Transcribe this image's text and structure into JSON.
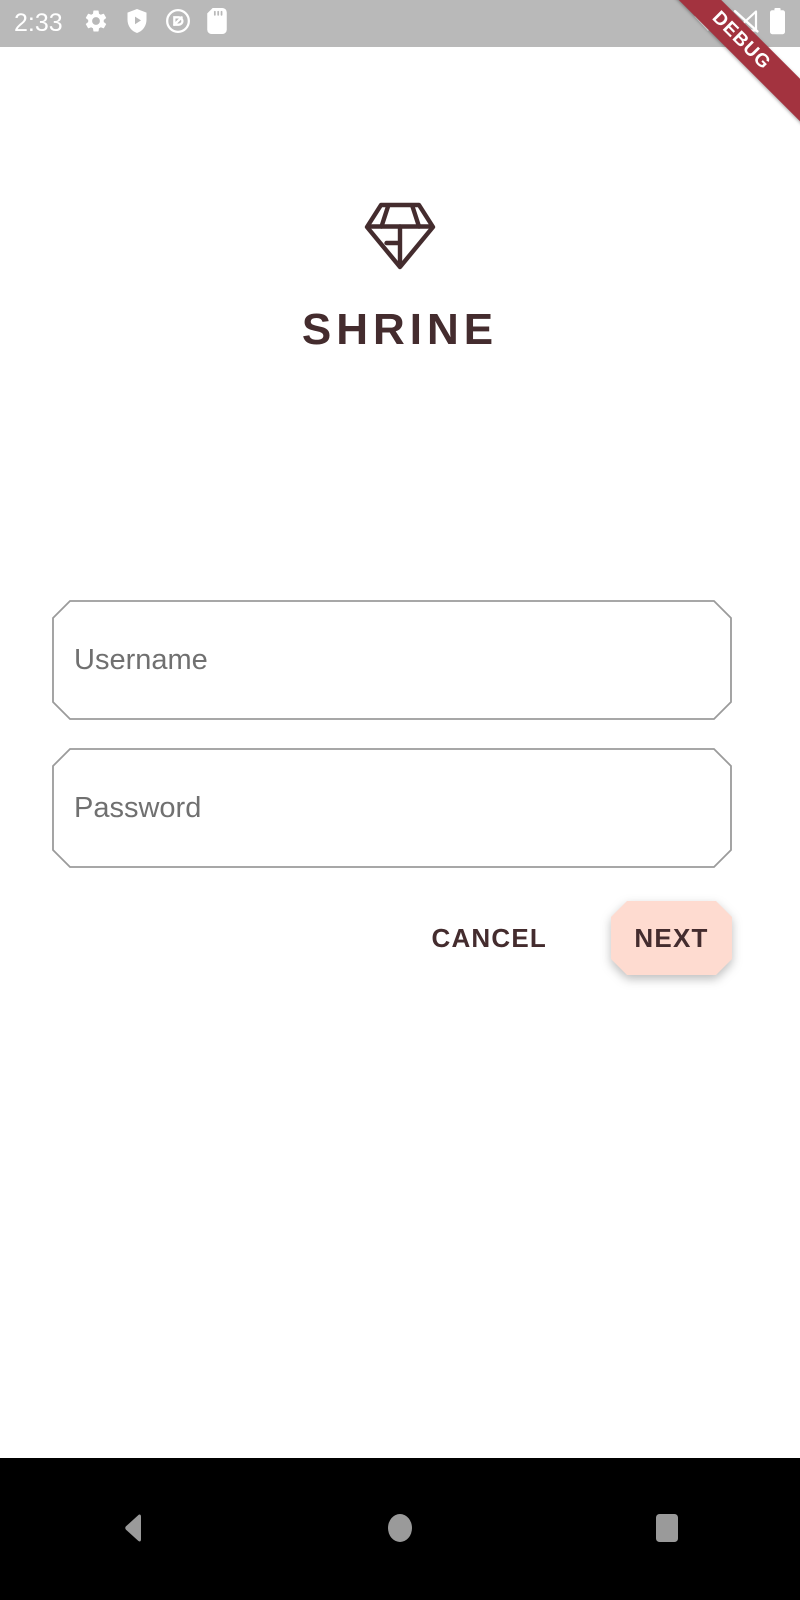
{
  "status_bar": {
    "clock": "2:33",
    "background": "#b9b9b9",
    "left_icons": [
      {
        "name": "settings-gear-icon",
        "label": "Settings"
      },
      {
        "name": "play-protect-shield-icon",
        "label": "Play Protect"
      },
      {
        "name": "do-not-disturb-icon",
        "label": "Do Not Disturb"
      },
      {
        "name": "sd-card-icon",
        "label": "SD Card"
      }
    ],
    "right_icons": [
      {
        "name": "wifi-icon",
        "label": "Wi-Fi"
      },
      {
        "name": "cell-signal-off-icon",
        "label": "No cellular signal"
      },
      {
        "name": "battery-icon",
        "label": "Battery"
      }
    ]
  },
  "debug_ribbon": {
    "label": "DEBUG",
    "color": "#a3333f",
    "text_color": "#ffffff"
  },
  "brand": {
    "logo_name": "shrine-diamond-logo",
    "title": "SHRINE",
    "title_color": "#442c2e"
  },
  "form": {
    "fields": [
      {
        "name": "username-input",
        "placeholder": "Username",
        "value": ""
      },
      {
        "name": "password-input",
        "placeholder": "Password",
        "value": ""
      }
    ],
    "border_color": "#9b9b9b",
    "placeholder_color": "#707070"
  },
  "actions": {
    "cancel_label": "CANCEL",
    "next_label": "NEXT",
    "next_background": "#fedbd0",
    "text_color": "#442c2e"
  },
  "nav_bar": {
    "background": "#000000",
    "icon_color": "#9a9a9a",
    "buttons": [
      {
        "name": "nav-back-button",
        "label": "Back"
      },
      {
        "name": "nav-home-button",
        "label": "Home"
      },
      {
        "name": "nav-recents-button",
        "label": "Recents"
      }
    ]
  }
}
